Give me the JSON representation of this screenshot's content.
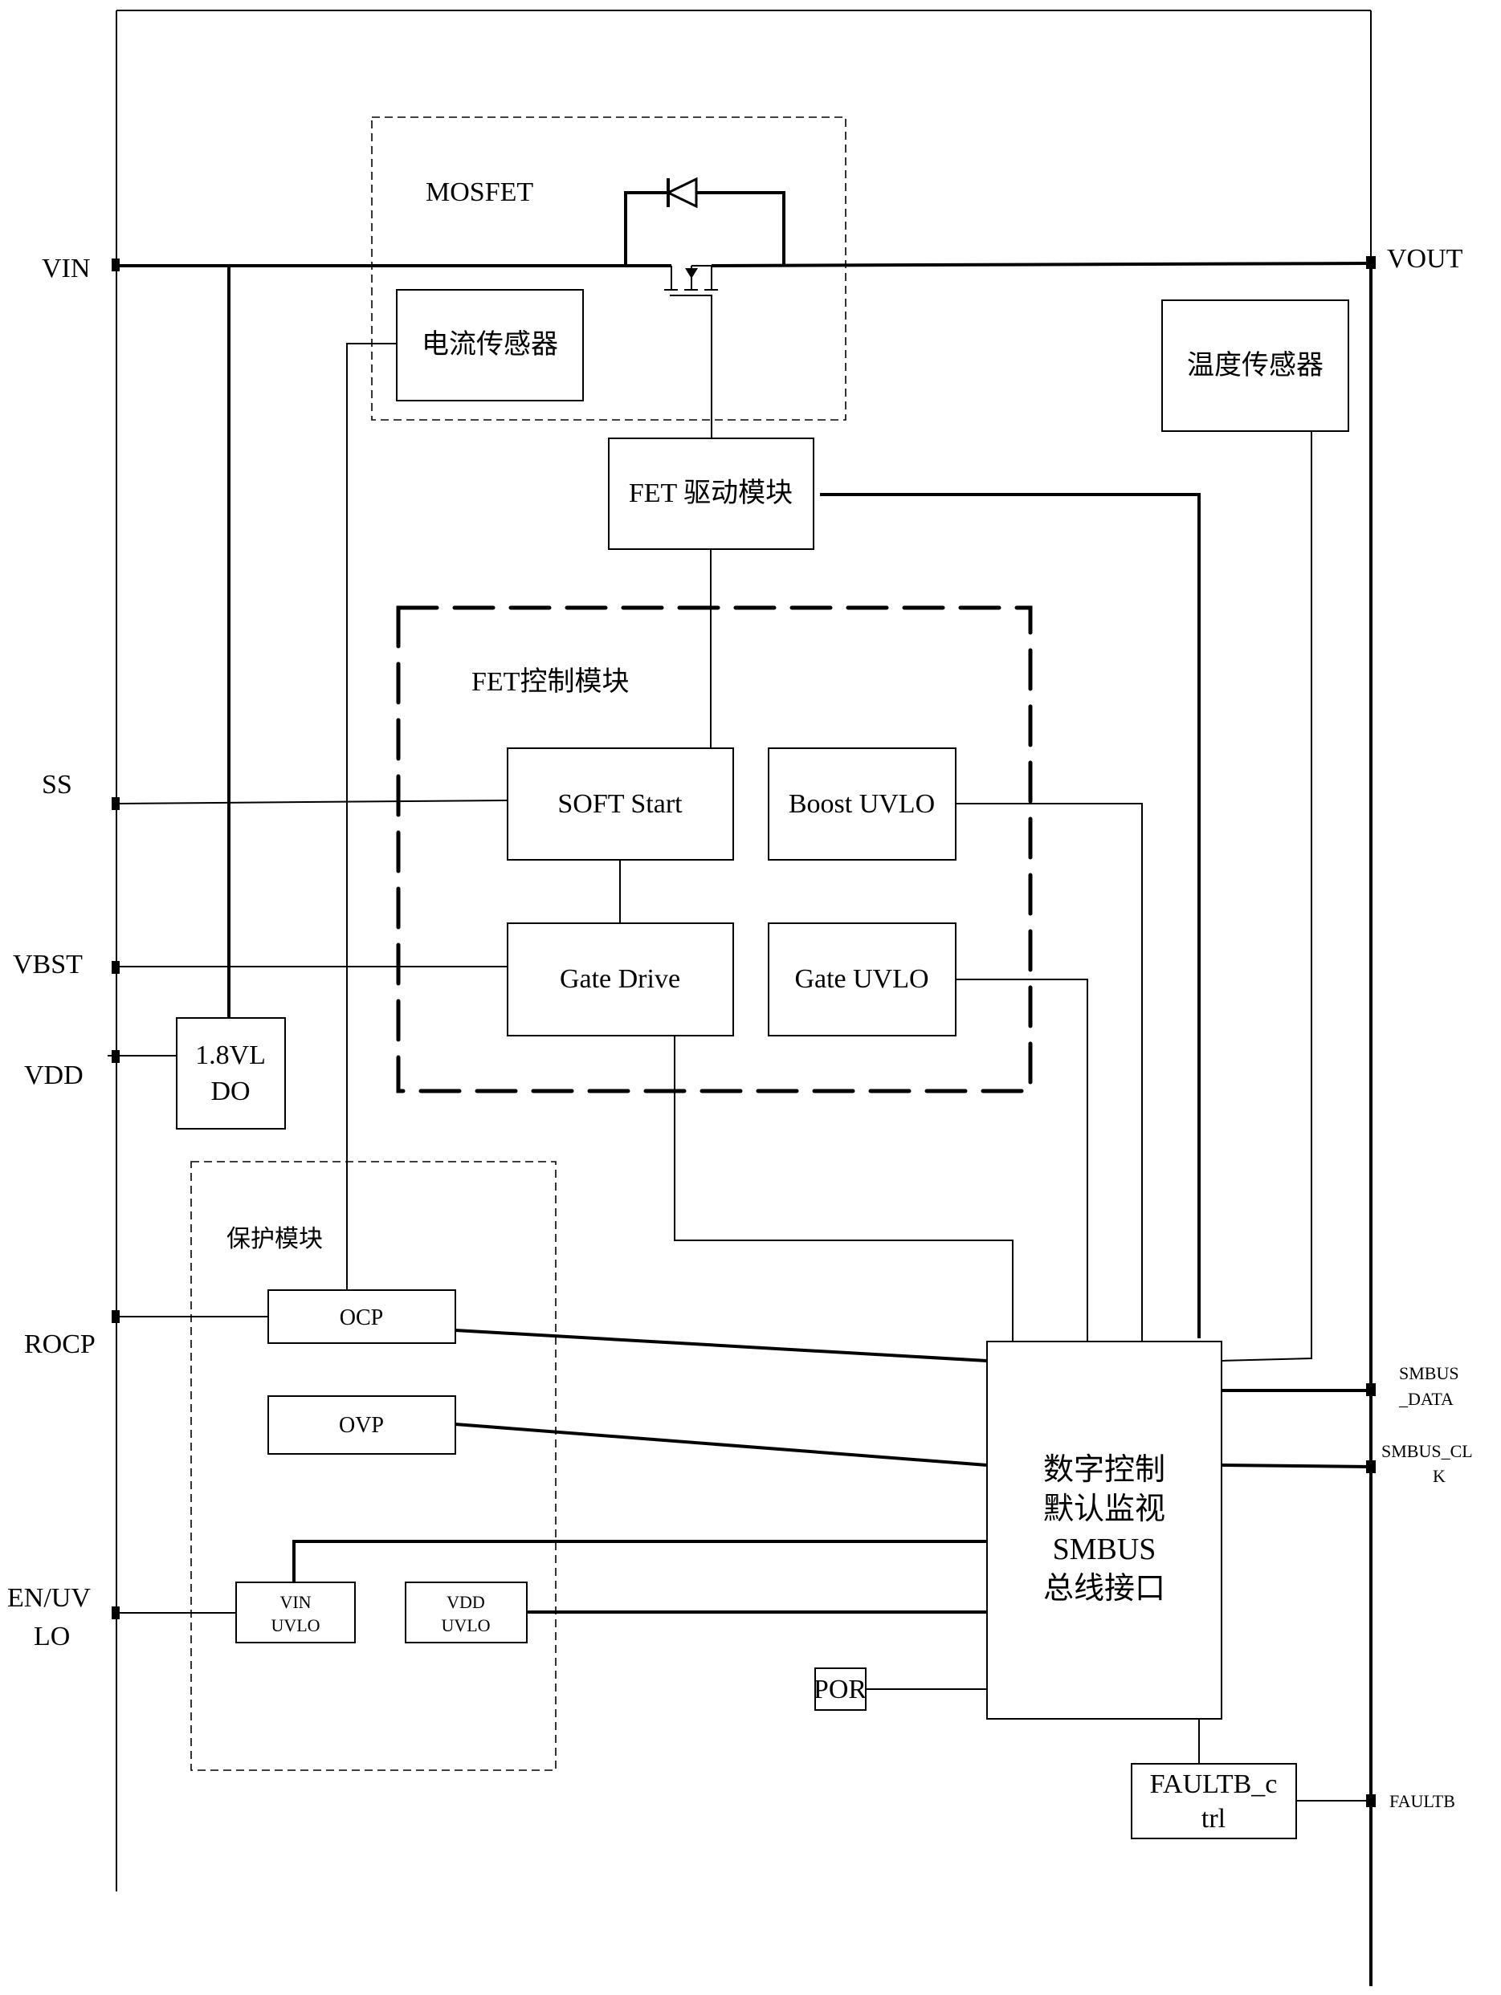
{
  "diagram": {
    "type": "block-diagram",
    "pins_left": {
      "vin": "VIN",
      "ss": "SS",
      "vbst": "VBST",
      "vdd": "VDD",
      "rocp": "ROCP",
      "en_uvlo_line1": "EN/UV",
      "en_uvlo_line2": "LO"
    },
    "pins_right": {
      "vout": "VOUT",
      "smbus_data_line1": "SMBUS",
      "smbus_data_line2": "_DATA",
      "smbus_clk_line1": "SMBUS_CL",
      "smbus_clk_line2": "K",
      "faultb": "FAULTB"
    },
    "groups": {
      "mosfet": "MOSFET",
      "fet_control": "FET控制模块",
      "protection": "保护模块"
    },
    "blocks": {
      "current_sensor": "电流传感器",
      "temp_sensor": "温度传感器",
      "fet_driver": "FET 驱动模块",
      "soft_start": "SOFT Start",
      "boost_uvlo": "Boost UVLO",
      "gate_drive": "Gate Drive",
      "gate_uvlo": "Gate UVLO",
      "ldo_line1": "1.8VL",
      "ldo_line2": "DO",
      "ocp": "OCP",
      "ovp": "OVP",
      "vin_uvlo_line1": "VIN",
      "vin_uvlo_line2": "UVLO",
      "vdd_uvlo_line1": "VDD",
      "vdd_uvlo_line2": "UVLO",
      "digital_line1": "数字控制",
      "digital_line2": "默认监视",
      "digital_line3": "SMBUS",
      "digital_line4": "总线接口",
      "por": "POR",
      "faultb_ctrl_line1": "FAULTB_c",
      "faultb_ctrl_line2": "trl"
    }
  }
}
